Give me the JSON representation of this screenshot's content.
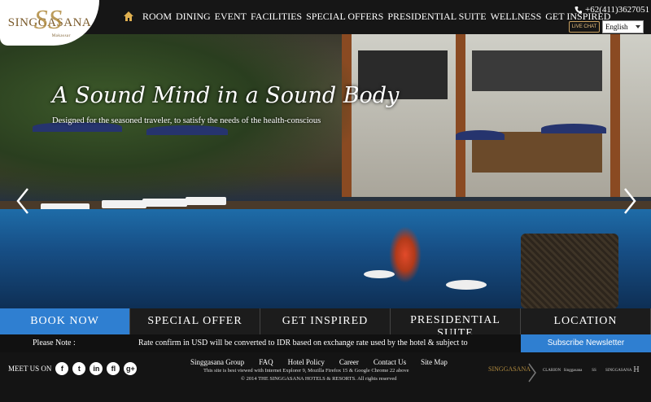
{
  "header": {
    "logo_text": "SINGGASANA",
    "logo_monogram": "SS",
    "logo_sub": "Makassar",
    "nav": [
      "ROOM",
      "DINING",
      "EVENT",
      "FACILITIES",
      "SPECIAL OFFERS",
      "PRESIDENTIAL SUITE",
      "WELLNESS",
      "GET INSPIRED"
    ],
    "phone": "+62(411)3627051",
    "live_chat": "LIVE CHAT",
    "language": "English"
  },
  "hero": {
    "title": "A Sound Mind in a Sound Body",
    "subtitle": "Designed for the seasoned traveler, to satisfy the needs of the health-conscious"
  },
  "bottom_bar": {
    "items": [
      "BOOK NOW",
      "SPECIAL OFFER",
      "GET INSPIRED",
      "PRESIDENTIAL SUITE",
      "LOCATION"
    ]
  },
  "note": {
    "label": "Please Note :",
    "text": "Rate confirm in USD will be converted to IDR based on exchange rate used by the hotel & subject to",
    "subscribe": "Subscribe Newsletter"
  },
  "footer": {
    "meet_us": "MEET US ON",
    "social": [
      "f",
      "t",
      "in",
      "fl",
      "g+"
    ],
    "links": [
      "Singgasana Group",
      "FAQ",
      "Hotel Policy",
      "Career",
      "Contact Us",
      "Site Map"
    ],
    "line1": "This site is best viewed with Internet Explorer 9, Mozilla Firefox 15 & Google Chrome 22 above",
    "line2": "© 2014 THE SINGGASANA HOTELS & RESORTS. All rights reserved",
    "brand_group": "SINGGASANA",
    "brands": [
      "CLARION",
      "Singgasana",
      "SS",
      "SINGGASANA",
      "H"
    ]
  }
}
